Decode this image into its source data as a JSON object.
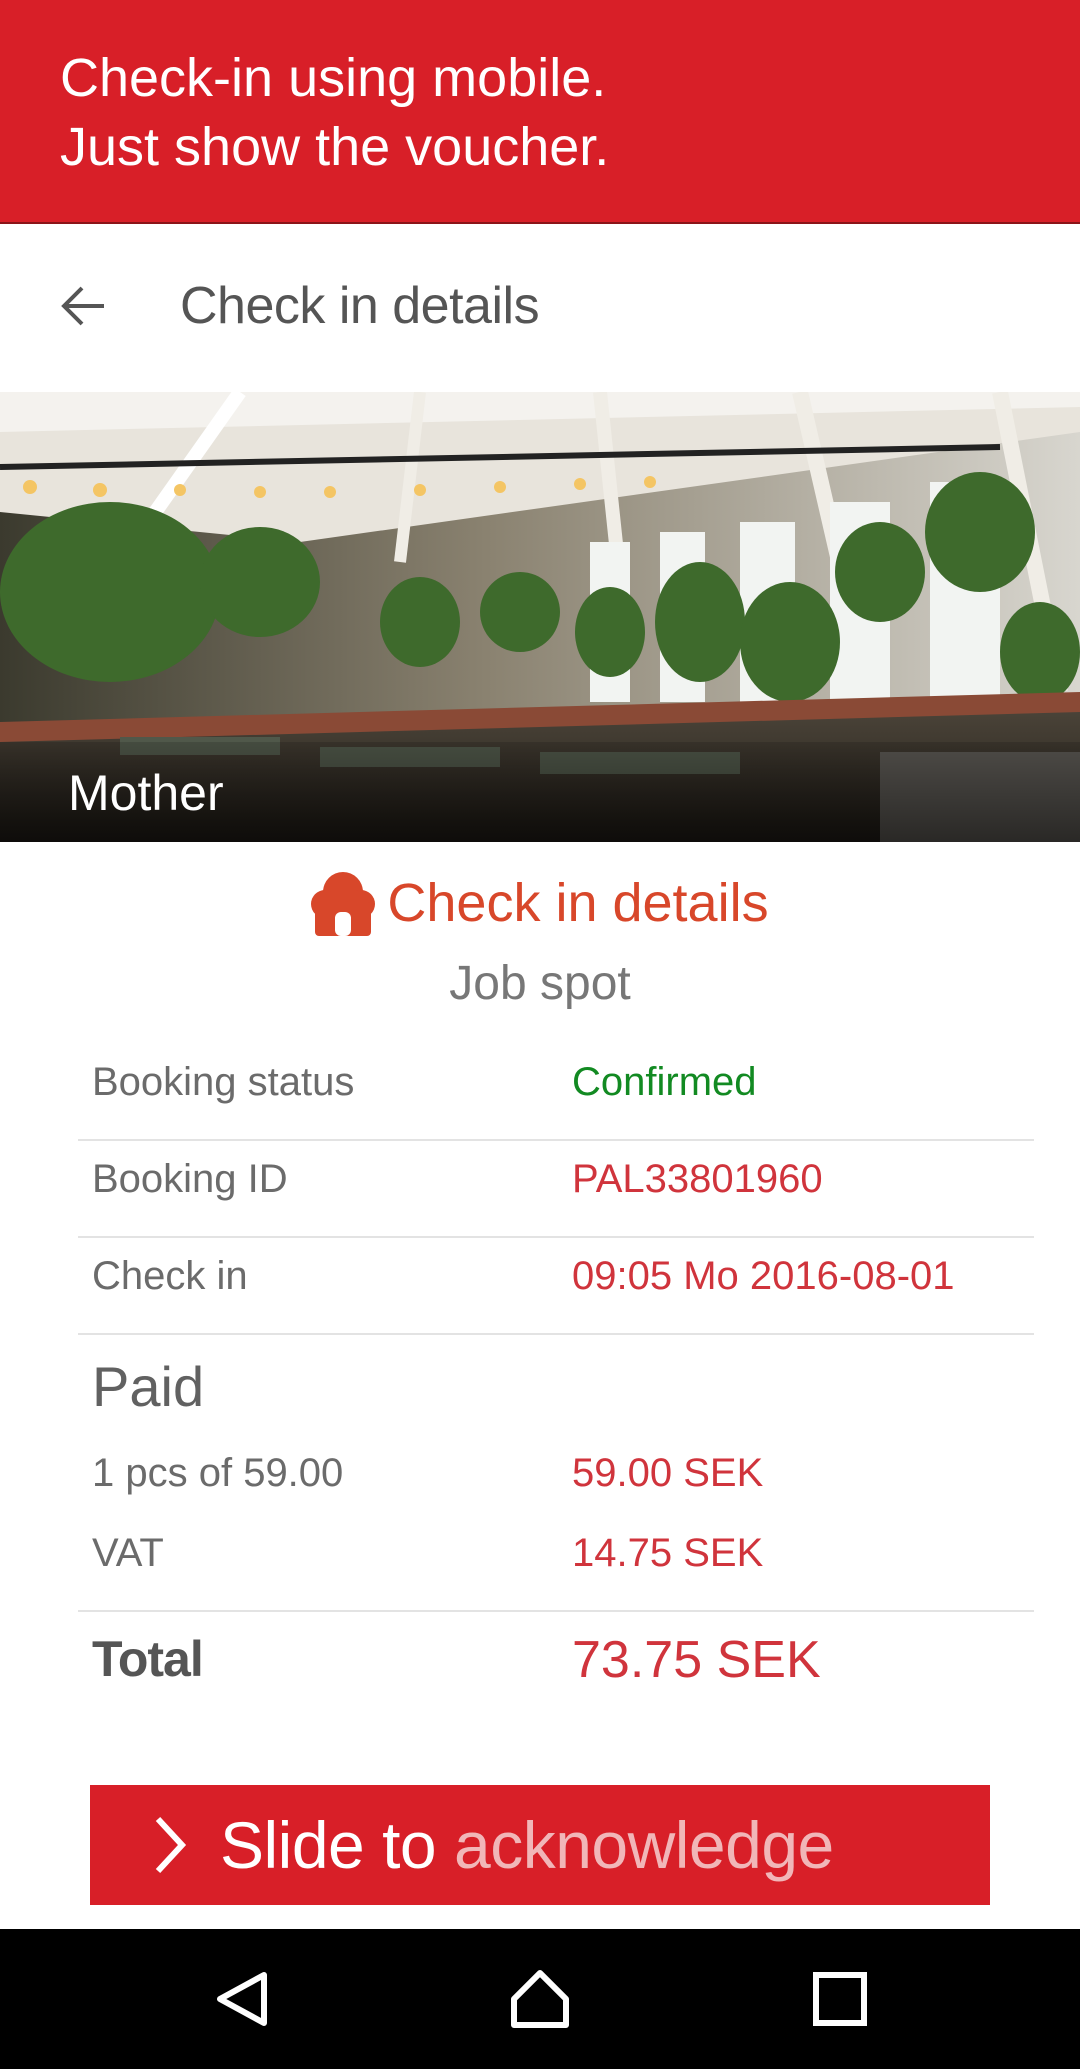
{
  "banner": {
    "line1": "Check-in using mobile.",
    "line2": "Just show the voucher."
  },
  "appbar": {
    "title": "Check in details",
    "back_icon": "arrow-left-icon"
  },
  "hero": {
    "venue_name": "Mother"
  },
  "section": {
    "icon": "house-icon",
    "title": "Check in details",
    "subtitle": "Job spot"
  },
  "details": [
    {
      "label": "Booking status",
      "value": "Confirmed",
      "status_color": "#128a22"
    },
    {
      "label": "Booking ID",
      "value": "PAL33801960"
    },
    {
      "label": "Check in",
      "value": "09:05 Mo 2016-08-01"
    }
  ],
  "paid": {
    "heading": "Paid",
    "lines": [
      {
        "label": "1 pcs of 59.00",
        "value": "59.00 SEK"
      },
      {
        "label": "VAT",
        "value": "14.75 SEK"
      }
    ],
    "total_label": "Total",
    "total_value": "73.75 SEK"
  },
  "slider": {
    "icon": "chevron-right-icon",
    "text_part1": "Slide to ",
    "text_part2": "acknowledge"
  },
  "navbar": {
    "back_icon": "nav-back-icon",
    "home_icon": "nav-home-icon",
    "recents_icon": "nav-recents-icon"
  },
  "colors": {
    "brand_red": "#d81f28",
    "accent_orange": "#d8472a",
    "value_red": "#d0343c",
    "confirmed_green": "#128a22"
  }
}
